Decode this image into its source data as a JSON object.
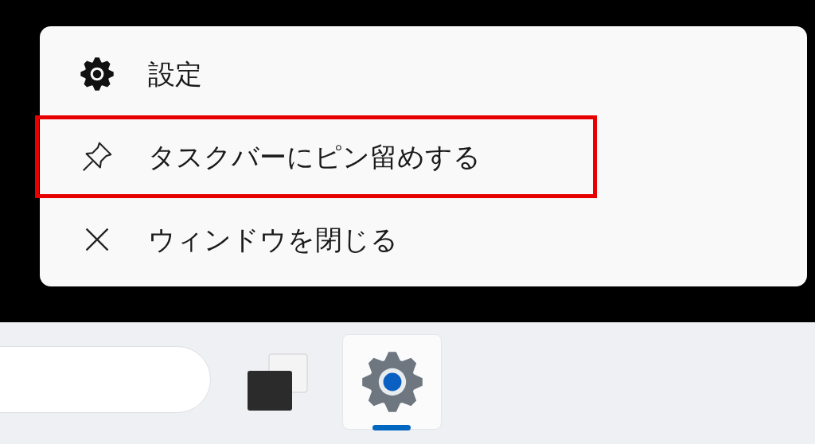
{
  "context_menu": {
    "items": [
      {
        "kind": "settings",
        "label": "設定",
        "highlighted": false
      },
      {
        "kind": "pin",
        "label": "タスクバーにピン留めする",
        "highlighted": true
      },
      {
        "kind": "close",
        "label": "ウィンドウを閉じる",
        "highlighted": false
      }
    ]
  },
  "taskbar": {
    "apps": [
      {
        "kind": "task-view",
        "running": false
      },
      {
        "kind": "settings",
        "running": true
      }
    ]
  }
}
